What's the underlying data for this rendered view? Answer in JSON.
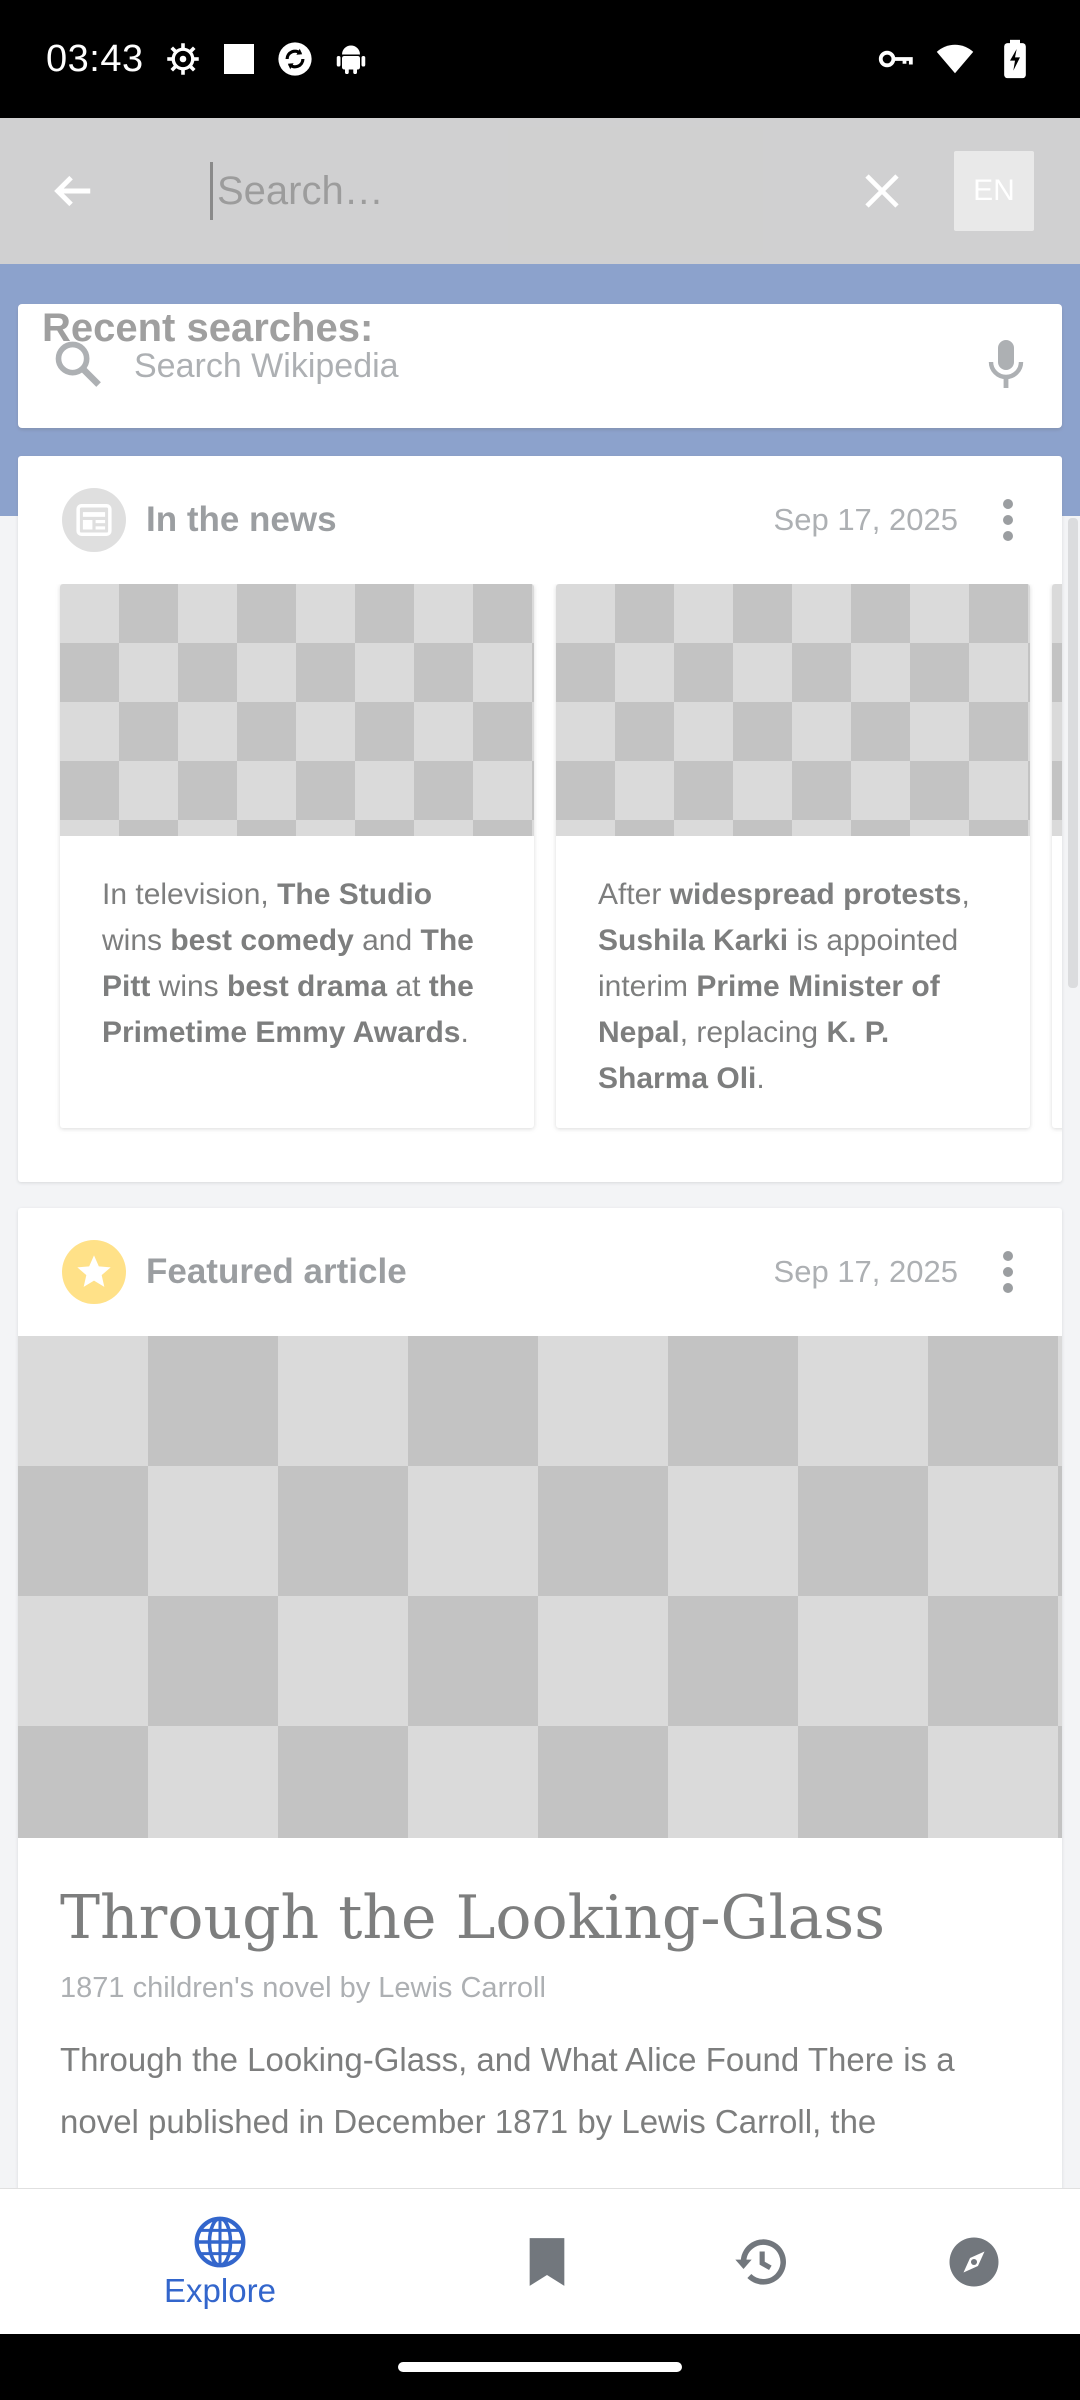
{
  "status_bar": {
    "time": "03:43",
    "left_icons": [
      "settings-gear-icon",
      "white-square-icon",
      "sync-icon",
      "android-icon"
    ],
    "right_icons": [
      "vpn-key-icon",
      "wifi-icon",
      "battery-charging-icon"
    ]
  },
  "search_toolbar": {
    "placeholder": "Search…",
    "value": "",
    "lang_label": "EN",
    "recent_label": "Recent searches:"
  },
  "search_card": {
    "placeholder": "Search Wikipedia"
  },
  "in_the_news": {
    "title": "In the news",
    "date": "Sep 17, 2025",
    "items": [
      {
        "segments": [
          {
            "t": "In television, ",
            "b": false
          },
          {
            "t": "The Studio",
            "b": true
          },
          {
            "t": " wins ",
            "b": false
          },
          {
            "t": "best comedy",
            "b": true
          },
          {
            "t": " and ",
            "b": false
          },
          {
            "t": "The Pitt",
            "b": true
          },
          {
            "t": " wins ",
            "b": false
          },
          {
            "t": "best drama",
            "b": true
          },
          {
            "t": " at ",
            "b": false
          },
          {
            "t": "the Primetime Emmy Awards",
            "b": true
          },
          {
            "t": ".",
            "b": false
          }
        ]
      },
      {
        "segments": [
          {
            "t": "After ",
            "b": false
          },
          {
            "t": "widespread protests",
            "b": true
          },
          {
            "t": ", ",
            "b": false
          },
          {
            "t": "Sushila Karki",
            "b": true
          },
          {
            "t": " is appointed interim ",
            "b": false
          },
          {
            "t": "Prime Minister of Nepal",
            "b": true
          },
          {
            "t": ", replacing ",
            "b": false
          },
          {
            "t": "K. P. Sharma Oli",
            "b": true
          },
          {
            "t": ".",
            "b": false
          }
        ]
      }
    ]
  },
  "featured_article": {
    "header_title": "Featured article",
    "date": "Sep 17, 2025",
    "title": "Through the Looking-Glass",
    "description": "1871 children's novel by Lewis Carroll",
    "extract": "Through the Looking-Glass, and What Alice Found There is a novel published in December 1871 by Lewis Carroll, the"
  },
  "bottom_nav": {
    "items": [
      {
        "name": "explore",
        "label": "Explore",
        "icon": "globe-icon",
        "active": true
      },
      {
        "name": "saved",
        "label": "",
        "icon": "bookmark-icon",
        "active": false
      },
      {
        "name": "history",
        "label": "",
        "icon": "history-icon",
        "active": false
      },
      {
        "name": "nearby",
        "label": "",
        "icon": "compass-icon",
        "active": false
      }
    ]
  },
  "colors": {
    "accent": "#3366cc",
    "header_blue": "#3a5fa8",
    "news_icon_bg": "#c8c8c8",
    "featured_icon_bg": "#fc3"
  }
}
